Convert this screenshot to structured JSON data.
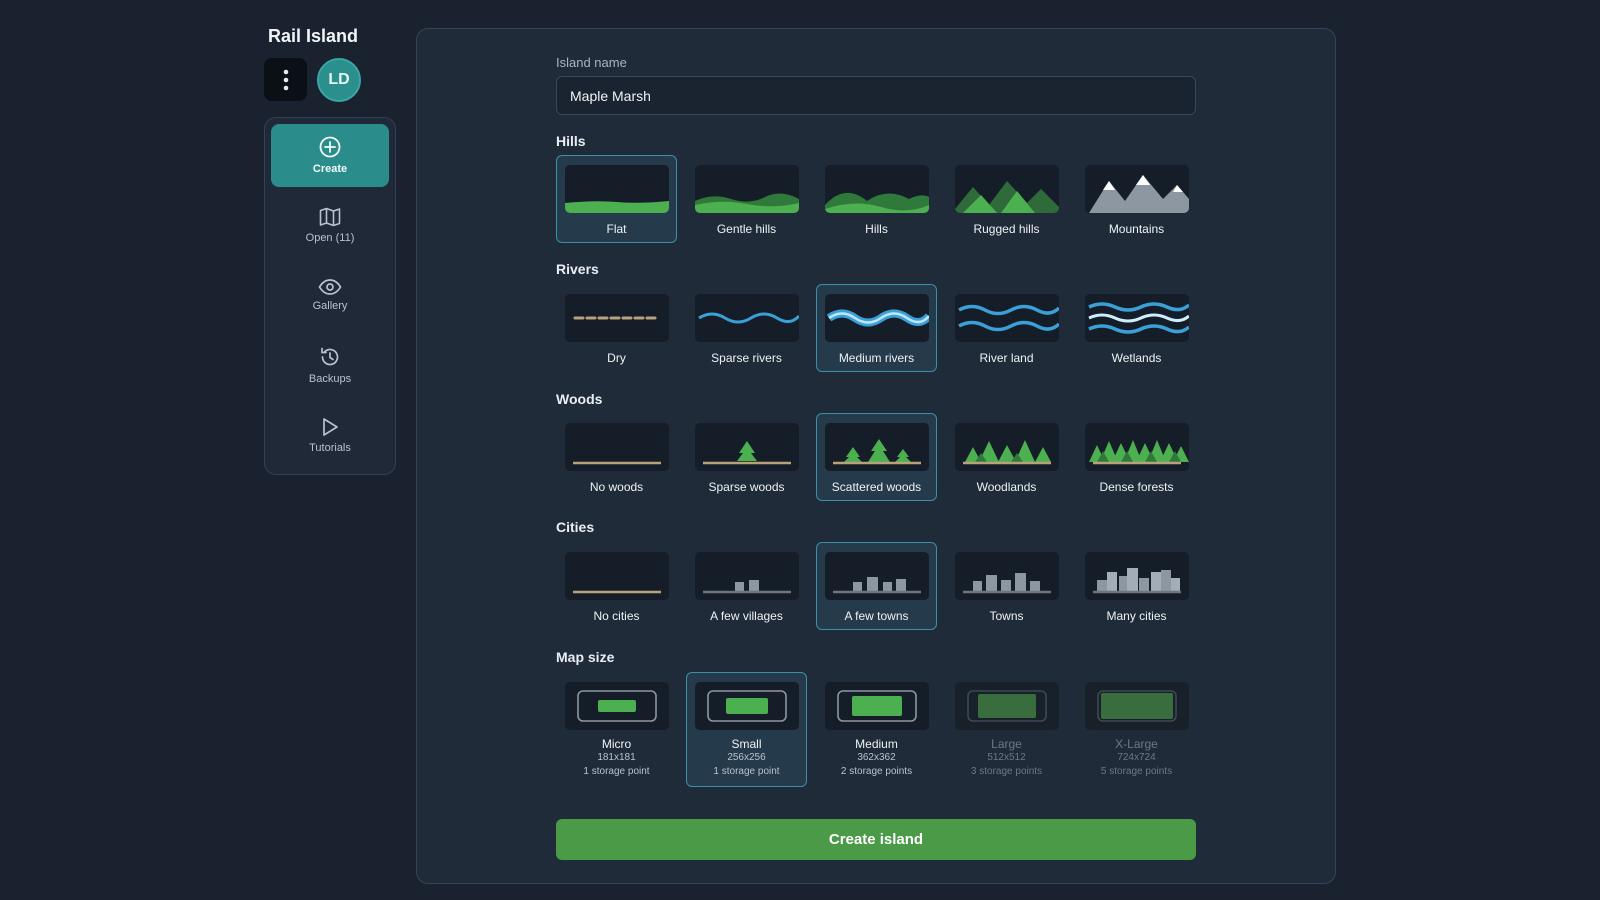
{
  "app": {
    "title": "Rail Island",
    "user_initials": "LD"
  },
  "nav": {
    "items": [
      {
        "label": "Create",
        "icon": "plus-circle-icon"
      },
      {
        "label": "Open (11)",
        "icon": "map-icon"
      },
      {
        "label": "Gallery",
        "icon": "eye-icon"
      },
      {
        "label": "Backups",
        "icon": "history-icon"
      },
      {
        "label": "Tutorials",
        "icon": "play-icon"
      }
    ]
  },
  "form": {
    "name_label": "Island name",
    "name_value": "Maple Marsh",
    "sections": {
      "hills": {
        "title": "Hills",
        "options": [
          "Flat",
          "Gentle hills",
          "Hills",
          "Rugged hills",
          "Mountains"
        ],
        "selected": "Flat"
      },
      "rivers": {
        "title": "Rivers",
        "options": [
          "Dry",
          "Sparse rivers",
          "Medium rivers",
          "River land",
          "Wetlands"
        ],
        "selected": "Medium rivers"
      },
      "woods": {
        "title": "Woods",
        "options": [
          "No woods",
          "Sparse woods",
          "Scattered woods",
          "Woodlands",
          "Dense forests"
        ],
        "selected": "Scattered woods"
      },
      "cities": {
        "title": "Cities",
        "options": [
          "No cities",
          "A few villages",
          "A few towns",
          "Towns",
          "Many cities"
        ],
        "selected": "A few towns"
      },
      "map_size": {
        "title": "Map size",
        "options": [
          {
            "label": "Micro",
            "dims": "181x181",
            "cost": "1 storage point"
          },
          {
            "label": "Small",
            "dims": "256x256",
            "cost": "1 storage point"
          },
          {
            "label": "Medium",
            "dims": "362x362",
            "cost": "2 storage points"
          },
          {
            "label": "Large",
            "dims": "512x512",
            "cost": "3 storage points"
          },
          {
            "label": "X-Large",
            "dims": "724x724",
            "cost": "5 storage points"
          }
        ],
        "selected": "Small"
      }
    },
    "submit_label": "Create island"
  },
  "colors": {
    "accent_teal": "#2b8c8c",
    "accent_green": "#4b9a47",
    "selected_border": "#3b8fa6",
    "water_blue": "#3aa0d8",
    "grass_green": "#4caf50"
  }
}
